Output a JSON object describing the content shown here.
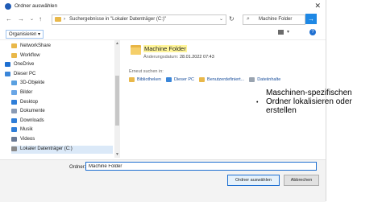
{
  "window": {
    "title": "Ordner auswählen",
    "close": "✕"
  },
  "nav": {
    "back": "←",
    "forward": "→",
    "up_dropdown": "⌄",
    "up": "↑"
  },
  "address": {
    "chevron": "›",
    "path": "Suchergebnisse in \"Lokaler Datenträger (C:)\"",
    "dropdown": "⌄",
    "refresh": "↻"
  },
  "search": {
    "icon": "⌕",
    "value": "Machine Folder",
    "go": "→"
  },
  "toolbar": {
    "organize": "Organisieren ▾",
    "view_dropdown": "▾",
    "help": "?"
  },
  "sidebar": {
    "items": [
      {
        "label": "NetworkShare",
        "indent": 2,
        "icon_color": "#e9b84a"
      },
      {
        "label": "Workflow",
        "indent": 2,
        "icon_color": "#e9b84a"
      },
      {
        "label": "OneDrive",
        "indent": 1,
        "icon_color": "#1e6fd1"
      },
      {
        "label": "Dieser PC",
        "indent": 1,
        "icon_color": "#3a86d9"
      },
      {
        "label": "3D-Objekte",
        "indent": 2,
        "icon_color": "#5aa0e0"
      },
      {
        "label": "Bilder",
        "indent": 2,
        "icon_color": "#6aa6e6"
      },
      {
        "label": "Desktop",
        "indent": 2,
        "icon_color": "#2f7ed8"
      },
      {
        "label": "Dokumente",
        "indent": 2,
        "icon_color": "#8a9bb5"
      },
      {
        "label": "Downloads",
        "indent": 2,
        "icon_color": "#2f7ed8"
      },
      {
        "label": "Musik",
        "indent": 2,
        "icon_color": "#2f7ed8"
      },
      {
        "label": "Videos",
        "indent": 2,
        "icon_color": "#6a7a95"
      },
      {
        "label": "Lokaler Datenträger (C:)",
        "indent": 2,
        "icon_color": "#8a8a8a",
        "selected": true
      }
    ],
    "scroll_up": "▲",
    "scroll_down": "▼"
  },
  "result": {
    "name": "Machine Folder",
    "date_label": "Änderungsdatum:",
    "date_value": "28.01.2022 07:43"
  },
  "search_again": {
    "label": "Erneut suchen in:",
    "scopes": [
      {
        "label": "Bibliotheken",
        "icon_color": "#e9b84a"
      },
      {
        "label": "Dieser PC",
        "icon_color": "#3a86d9"
      },
      {
        "label": "Benutzerdefiniert...",
        "icon_color": "#e9b84a"
      },
      {
        "label": "Dateiinhalte",
        "icon_color": "#9aa4b0"
      }
    ]
  },
  "footer": {
    "folder_label": "Ordner:",
    "folder_value": "Machine Folder",
    "select_button": "Ordner auswählen",
    "cancel_button": "Abbrechen"
  },
  "callout": {
    "dot": "•",
    "lines": [
      "Maschinen-spezifischen",
      "Ordner lokalisieren oder",
      "erstellen"
    ]
  }
}
